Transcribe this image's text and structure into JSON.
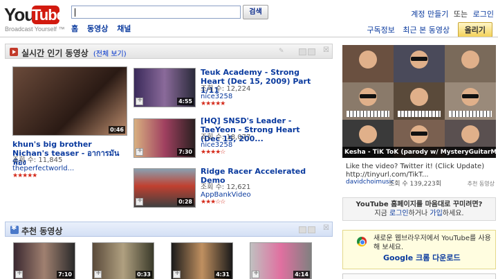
{
  "logo": {
    "word1": "You",
    "word2": "Tube",
    "tagline": "Broadcast Yourself ™"
  },
  "search": {
    "value": "",
    "button_label": "검색"
  },
  "nav": {
    "home": "홈",
    "videos": "동영상",
    "channels": "채널"
  },
  "account": {
    "signup": "계정 만들기",
    "or": "또는",
    "login": "로그인"
  },
  "header_links": {
    "subscriptions": "구독정보",
    "recent": "최근 본 동영상",
    "upload": "올리기"
  },
  "featured": {
    "title": "실시간 인기 동영상",
    "see_all": "(전체 보기)",
    "main_video": {
      "title": "khun's big brother Nichan's teaser - อาการมันฟ้อง",
      "views": "조회 수: 11,845",
      "user": "theperfectworld...",
      "duration": "0:46",
      "rating": 5
    },
    "videos": [
      {
        "title": "Teuk Academy - Strong Heart (Dec 15, 2009) Part 1/11",
        "views": "조회 수: 12,224",
        "user": "nice3258",
        "duration": "4:55",
        "rating": 5
      },
      {
        "title": "[HQ] SNSD's Leader - TaeYeon - Strong Heart (Dec 15, 200...",
        "views": "조회 수: 18,077",
        "user": "nice3258",
        "duration": "7:30",
        "rating": 4.5
      },
      {
        "title": "Ridge Racer Accelerated Demo",
        "views": "조회 수: 12,621",
        "user": "AppBankVideo",
        "duration": "0:28",
        "rating": 3.5
      }
    ]
  },
  "recommended": {
    "title": "추천 동영상",
    "durations": [
      "7:10",
      "0:33",
      "4:31",
      "4:14"
    ]
  },
  "banner": {
    "caption": "Kesha - TiK ToK (parody w/ MysteryGuitarMan) 2:27",
    "ad_text": "Like the video? Twitter it! (Click Update) http://tinyurl.com/TikT...",
    "channel": "davidchoimusic",
    "views": "조회 수 139,223회",
    "report": "추천 동영상"
  },
  "customize": {
    "title": "YouTube 홈페이지를 마음대로 꾸미려면?",
    "line_prefix": "지금 ",
    "login": "로그인",
    "or": "하거나 ",
    "signup": "가입",
    "suffix": "하세요."
  },
  "chrome_promo": {
    "text": "새로운 웹브라우저에서 YouTube를 사용해 보세요.",
    "link": "Google 크롬 다운로드"
  },
  "colors": {
    "accent_red": "#d21a0f",
    "link_blue": "#0a3a9e",
    "star_red": "#d42a1a"
  }
}
